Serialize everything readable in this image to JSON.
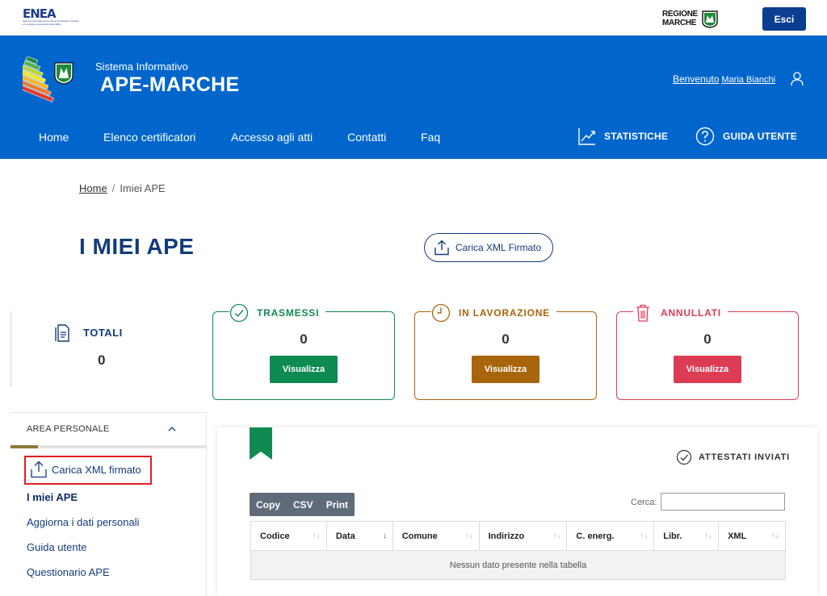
{
  "topbar": {
    "enea_logo": "ENEA",
    "enea_tagline": "Agenzia nazionale per le nuove tecnologie, l'energia e lo sviluppo economico sostenibile",
    "regione_line1": "REGIONE",
    "regione_line2": "MARCHE",
    "logout_label": "Esci"
  },
  "header": {
    "system_label": "Sistema Informativo",
    "app_title": "APE-MARCHE",
    "welcome_label": "Benvenuto",
    "user_name": "Maria Bianchi",
    "nav": [
      "Home",
      "Elenco certificatori",
      "Accesso agli atti",
      "Contatti",
      "Faq"
    ],
    "stats_label": "STATISTICHE",
    "guide_label": "GUIDA UTENTE"
  },
  "breadcrumb": {
    "home": "Home",
    "separator": "/",
    "current": "Imiei APE"
  },
  "page": {
    "title": "I MIEI APE",
    "upload_button": "Carica XML Firmato"
  },
  "summary": {
    "totali": {
      "label": "TOTALI",
      "value": "0"
    },
    "cards": [
      {
        "label": "TRASMESSI",
        "value": "0",
        "button": "Visualizza",
        "color": "#0f8a53",
        "icon": "check-circle-icon"
      },
      {
        "label": "IN LAVORAZIONE",
        "value": "0",
        "button": "Visualizza",
        "color": "#a8650b",
        "icon": "clock-icon"
      },
      {
        "label": "ANNULLATI",
        "value": "0",
        "button": "Visualizza",
        "color": "#dc3d55",
        "icon": "trash-icon"
      }
    ]
  },
  "sidebar": {
    "header": "AREA PERSONALE",
    "items": [
      "Carica XML firmato",
      "I miei APE",
      "Aggiorna i dati personali",
      "Guida utente",
      "Questionario APE"
    ]
  },
  "panel": {
    "section_label": "ATTESTATI INVIATI",
    "export_buttons": [
      "Copy",
      "CSV",
      "Print"
    ],
    "search_label": "Cerca:",
    "search_value": "",
    "columns": [
      "Codice",
      "Data",
      "Comune",
      "Indirizzo",
      "C. energ.",
      "Libr.",
      "XML"
    ],
    "empty_message": "Nessun dato presente nella tabella"
  },
  "colors": {
    "primary_blue": "#0066cc",
    "navy": "#123c7a",
    "highlight_red": "#e02020"
  }
}
